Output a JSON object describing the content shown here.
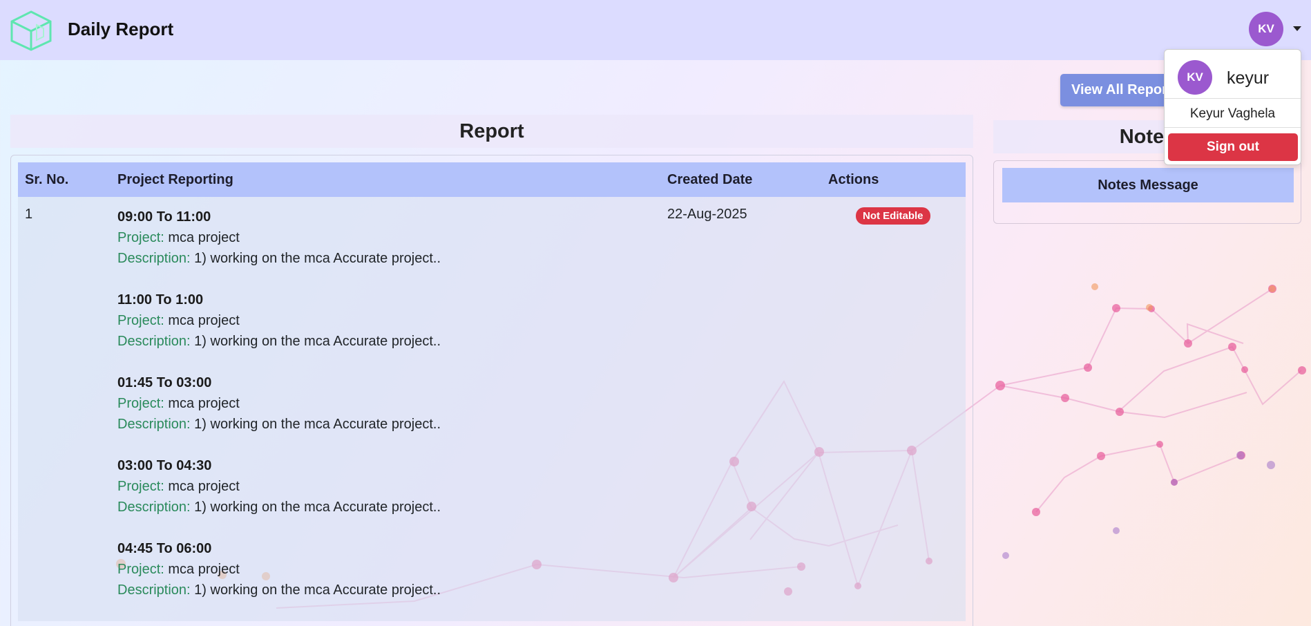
{
  "header": {
    "app_title": "Daily Report",
    "avatar_initials": "KV"
  },
  "toolbar": {
    "view_all_label": "View All Reports"
  },
  "report": {
    "title": "Report",
    "columns": [
      "Sr. No.",
      "Project Reporting",
      "Created Date",
      "Actions"
    ],
    "rows": [
      {
        "sr_no": "1",
        "created_date": "22-Aug-2025",
        "action_badge": "Not Editable",
        "entries": [
          {
            "time": "09:00 To 11:00",
            "project_label": "Project:",
            "project": "mca project",
            "description_label": "Description:",
            "description": "1) working on the mca Accurate project.."
          },
          {
            "time": "11:00 To 1:00",
            "project_label": "Project:",
            "project": "mca project",
            "description_label": "Description:",
            "description": "1) working on the mca Accurate project.."
          },
          {
            "time": "01:45 To 03:00",
            "project_label": "Project:",
            "project": "mca project",
            "description_label": "Description:",
            "description": "1) working on the mca Accurate project.."
          },
          {
            "time": "03:00 To 04:30",
            "project_label": "Project:",
            "project": "mca project",
            "description_label": "Description:",
            "description": "1) working on the mca Accurate project.."
          },
          {
            "time": "04:45 To 06:00",
            "project_label": "Project:",
            "project": "mca project",
            "description_label": "Description:",
            "description": "1) working on the mca Accurate project.."
          }
        ]
      }
    ]
  },
  "notes": {
    "title": "Notes",
    "column_header": "Notes Message"
  },
  "user_menu": {
    "avatar_initials": "KV",
    "username": "keyur",
    "full_name": "Keyur Vaghela",
    "signout_label": "Sign out"
  },
  "colors": {
    "header_bg": "#dcdcff",
    "table_header_bg": "#b3c2fb",
    "avatar_bg": "#9b59cf",
    "danger": "#dc3545",
    "label_green": "#2a8a5b",
    "view_all_bg": "#7b8fe0"
  }
}
